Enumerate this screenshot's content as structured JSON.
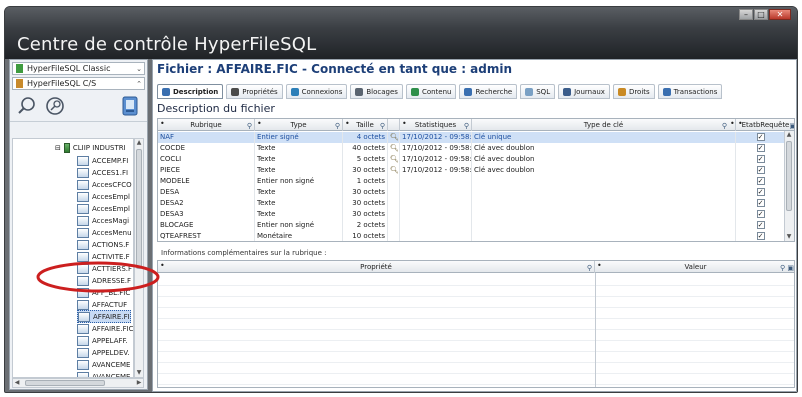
{
  "window": {
    "title": "Centre de contrôle HyperFileSQL",
    "controls": [
      "minimize-icon",
      "maximize-icon",
      "close-icon"
    ]
  },
  "left": {
    "combo1": "HyperFileSQL Classic",
    "combo2": "HyperFileSQL C/S",
    "tools": [
      "search-icon",
      "zoom-icon",
      "refresh-icon"
    ],
    "tree_root": "CLIIP INDUSTRI",
    "tree_items": [
      "ACCEMP.FI",
      "ACCES1.FI",
      "AccesCFCO",
      "AccesEmpl",
      "AccesEmpl",
      "AccesMagi",
      "AccesMenu",
      "ACTIONS.F",
      "ACTIVITE.F",
      "ACTTIERS.F",
      "ADRESSE.F",
      "AFF_BL.FIC",
      "AFFACTUF",
      "AFFAIRE.FI",
      "AFFAIRE.FIC",
      "APPELAFF.",
      "APPELDEV.",
      "AVANCEME",
      "AVANCEME"
    ],
    "selected_index": 13
  },
  "right": {
    "heading": "Fichier : AFFAIRE.FIC - Connecté en tant que : admin",
    "tabs": [
      {
        "label": "Description",
        "icon": "description-icon",
        "color": "#3a6fb0"
      },
      {
        "label": "Propriétés",
        "icon": "properties-icon",
        "color": "#4b4b4b"
      },
      {
        "label": "Connexions",
        "icon": "connections-icon",
        "color": "#2c7fb8"
      },
      {
        "label": "Blocages",
        "icon": "lock-icon",
        "color": "#5a6470"
      },
      {
        "label": "Contenu",
        "icon": "content-icon",
        "color": "#2f8f4a"
      },
      {
        "label": "Recherche",
        "icon": "search-icon",
        "color": "#3a6fb0"
      },
      {
        "label": "SQL",
        "icon": "sql-icon",
        "color": "#7aa0c4"
      },
      {
        "label": "Journaux",
        "icon": "journal-icon",
        "color": "#3a5c8a"
      },
      {
        "label": "Droits",
        "icon": "rights-icon",
        "color": "#c98a24"
      },
      {
        "label": "Transactions",
        "icon": "transactions-icon",
        "color": "#3a6fb0"
      }
    ],
    "subheading": "Description du fichier",
    "grid1": {
      "columns": [
        "Rubrique",
        "Type",
        "Taille",
        "Statistiques",
        "Type de clé",
        "EtatbRequête"
      ],
      "rows": [
        {
          "rubrique": "NAF",
          "type": "Entier signé",
          "taille": "4 octets",
          "key": true,
          "stats": "17/10/2012 - 09:58:",
          "typecle": "Clé unique",
          "etat": "✓"
        },
        {
          "rubrique": "COCDE",
          "type": "Texte",
          "taille": "40 octets",
          "key": true,
          "stats": "17/10/2012 - 09:58:",
          "typecle": "Clé avec doublon",
          "etat": "✓"
        },
        {
          "rubrique": "COCLI",
          "type": "Texte",
          "taille": "5 octets",
          "key": true,
          "stats": "17/10/2012 - 09:58:",
          "typecle": "Clé avec doublon",
          "etat": "✓"
        },
        {
          "rubrique": "PIECE",
          "type": "Texte",
          "taille": "30 octets",
          "key": true,
          "stats": "17/10/2012 - 09:58:",
          "typecle": "Clé avec doublon",
          "etat": "✓"
        },
        {
          "rubrique": "MODELE",
          "type": "Entier non signé",
          "taille": "1 octets",
          "key": false,
          "stats": "",
          "typecle": "",
          "etat": "✓"
        },
        {
          "rubrique": "DESA",
          "type": "Texte",
          "taille": "30 octets",
          "key": false,
          "stats": "",
          "typecle": "",
          "etat": "✓"
        },
        {
          "rubrique": "DESA2",
          "type": "Texte",
          "taille": "30 octets",
          "key": false,
          "stats": "",
          "typecle": "",
          "etat": "✓"
        },
        {
          "rubrique": "DESA3",
          "type": "Texte",
          "taille": "30 octets",
          "key": false,
          "stats": "",
          "typecle": "",
          "etat": "✓"
        },
        {
          "rubrique": "BLOCAGE",
          "type": "Entier non signé",
          "taille": "2 octets",
          "key": false,
          "stats": "",
          "typecle": "",
          "etat": "✓"
        },
        {
          "rubrique": "QTEAFREST",
          "type": "Monétaire",
          "taille": "10 octets",
          "key": false,
          "stats": "",
          "typecle": "",
          "etat": "✓"
        }
      ],
      "selected_row": 0
    },
    "info_label": "Informations complémentaires sur la rubrique :",
    "grid2": {
      "columns": [
        "Propriété",
        "Valeur"
      ]
    }
  },
  "colors": {
    "accent": "#1d3f78",
    "selection": "#cfe0f6",
    "annotation": "#cc1f1f"
  }
}
